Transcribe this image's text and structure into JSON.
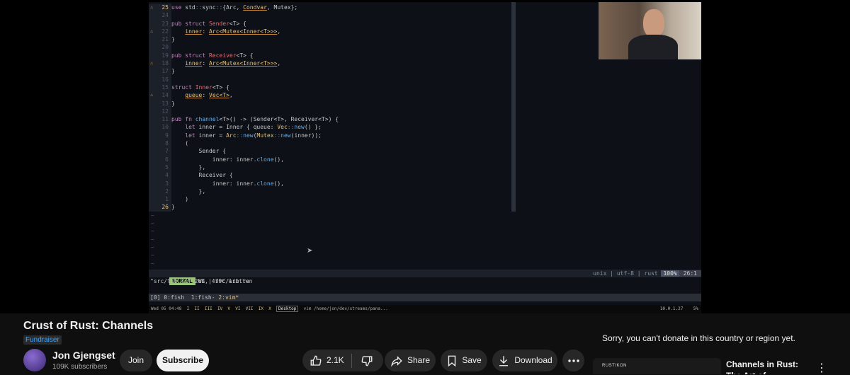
{
  "editor": {
    "lines": [
      {
        "num": "25",
        "warn": true,
        "cur": true,
        "parts": [
          [
            "k",
            "use "
          ],
          [
            "",
            "std"
          ],
          [
            "p",
            "::"
          ],
          [
            "",
            "sync"
          ],
          [
            "p",
            "::"
          ],
          [
            "",
            "{Arc, "
          ],
          [
            "u",
            "Condvar"
          ],
          [
            "",
            ", Mutex};"
          ]
        ]
      },
      {
        "num": "24",
        "parts": []
      },
      {
        "num": "23",
        "parts": [
          [
            "k",
            "pub struct "
          ],
          [
            "r",
            "Sender"
          ],
          [
            "",
            "<T> {"
          ]
        ]
      },
      {
        "num": "22",
        "warn": true,
        "parts": [
          [
            "",
            "    "
          ],
          [
            "u",
            "inner"
          ],
          [
            "",
            ": "
          ],
          [
            "u",
            "Arc<Mutex<Inner<T>>>"
          ],
          [
            "",
            ","
          ]
        ]
      },
      {
        "num": "21",
        "parts": [
          [
            "",
            "}"
          ]
        ]
      },
      {
        "num": "20",
        "parts": []
      },
      {
        "num": "19",
        "parts": [
          [
            "k",
            "pub struct "
          ],
          [
            "r",
            "Receiver"
          ],
          [
            "",
            "<T> {"
          ]
        ]
      },
      {
        "num": "18",
        "warn": true,
        "parts": [
          [
            "",
            "    "
          ],
          [
            "u",
            "inner"
          ],
          [
            "",
            ": "
          ],
          [
            "u",
            "Arc<Mutex<Inner<T>>>"
          ],
          [
            "",
            ","
          ]
        ]
      },
      {
        "num": "17",
        "parts": [
          [
            "",
            "}"
          ]
        ]
      },
      {
        "num": "16",
        "parts": []
      },
      {
        "num": "15",
        "parts": [
          [
            "k",
            "struct "
          ],
          [
            "r",
            "Inner"
          ],
          [
            "",
            "<T> {"
          ]
        ]
      },
      {
        "num": "14",
        "warn": true,
        "parts": [
          [
            "",
            "    "
          ],
          [
            "u",
            "queue"
          ],
          [
            "",
            ": "
          ],
          [
            "u",
            "Vec<T>"
          ],
          [
            "",
            ","
          ]
        ]
      },
      {
        "num": "13",
        "parts": [
          [
            "",
            "}"
          ]
        ]
      },
      {
        "num": "12",
        "parts": []
      },
      {
        "num": "11",
        "parts": [
          [
            "k",
            "pub fn "
          ],
          [
            "f",
            "channel"
          ],
          [
            "",
            "<T>() -> (Sender<T>, Receiver<T>) {"
          ]
        ]
      },
      {
        "num": "10",
        "parts": [
          [
            "",
            "    "
          ],
          [
            "k",
            "let "
          ],
          [
            "",
            "inner = Inner { queue: "
          ],
          [
            "t",
            "Vec"
          ],
          [
            "p",
            "::"
          ],
          [
            "f",
            "new"
          ],
          [
            "",
            "() };"
          ]
        ]
      },
      {
        "num": "9",
        "parts": [
          [
            "",
            "    "
          ],
          [
            "k",
            "let "
          ],
          [
            "",
            "inner = "
          ],
          [
            "t",
            "Arc"
          ],
          [
            "p",
            "::"
          ],
          [
            "f",
            "new"
          ],
          [
            "",
            "("
          ],
          [
            "t",
            "Mutex"
          ],
          [
            "p",
            "::"
          ],
          [
            "f",
            "new"
          ],
          [
            "",
            "(inner));"
          ]
        ]
      },
      {
        "num": "8",
        "parts": [
          [
            "",
            "    ("
          ]
        ]
      },
      {
        "num": "7",
        "parts": [
          [
            "",
            "        Sender {"
          ]
        ]
      },
      {
        "num": "6",
        "parts": [
          [
            "",
            "            inner: inner."
          ],
          [
            "f",
            "clone"
          ],
          [
            "",
            "(),"
          ]
        ]
      },
      {
        "num": "5",
        "parts": [
          [
            "",
            "        },"
          ]
        ]
      },
      {
        "num": "4",
        "parts": [
          [
            "",
            "        Receiver {"
          ]
        ]
      },
      {
        "num": "3",
        "parts": [
          [
            "",
            "            inner: inner."
          ],
          [
            "f",
            "clone"
          ],
          [
            "",
            "(),"
          ]
        ]
      },
      {
        "num": "2",
        "parts": [
          [
            "",
            "        },"
          ]
        ]
      },
      {
        "num": "1",
        "parts": [
          [
            "",
            "    )"
          ]
        ]
      },
      {
        "num": "26",
        "cur": true,
        "parts": [
          [
            "",
            "}"
          ]
        ]
      }
    ],
    "tildes": 7,
    "status": {
      "mode": "NORMAL",
      "info": "W4 | src/lib.rs",
      "right": "unix | utf-8 | rust ",
      "pct": "100%",
      "pos": "26:1"
    },
    "message": "\"src/lib.rs\" 26L, 479C written",
    "tmux": {
      "left": "[0] 0:fish  1:fish- ",
      "active": "2:vim*"
    },
    "taskbar": {
      "time": "Wed 05 04:48",
      "workspaces": "I  II  III  IV  V  VI  VII  IX  X ",
      "box": "Desktop",
      "window": "vim /home/jon/dev/streams/pana...",
      "right": "10.0.1.27    5%"
    }
  },
  "video": {
    "title": "Crust of Rust: Channels",
    "badge": "Fundraiser"
  },
  "channel": {
    "name": "Jon Gjengset",
    "subscribers": "109K subscribers",
    "join": "Join",
    "subscribe": "Subscribe"
  },
  "actions": {
    "likes": "2.1K",
    "share": "Share",
    "save": "Save",
    "download": "Download"
  },
  "sidebar": {
    "donate_msg": "Sorry, you can't donate in this country or region yet.",
    "rec_title": "Channels in Rust: The Art of Concurrency by",
    "rec_tag": "RUSTIKON"
  }
}
